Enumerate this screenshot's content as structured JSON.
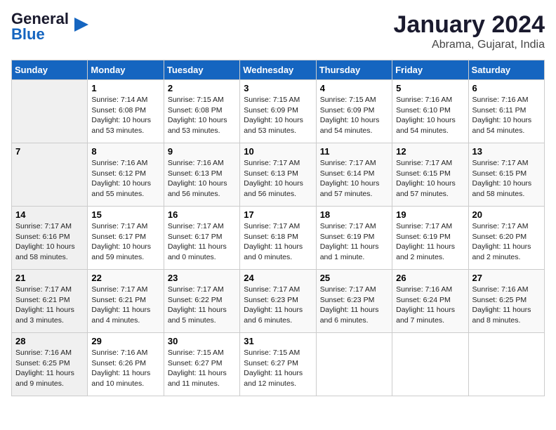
{
  "header": {
    "logo_general": "General",
    "logo_blue": "Blue",
    "title": "January 2024",
    "subtitle": "Abrama, Gujarat, India"
  },
  "weekdays": [
    "Sunday",
    "Monday",
    "Tuesday",
    "Wednesday",
    "Thursday",
    "Friday",
    "Saturday"
  ],
  "weeks": [
    [
      {
        "day": "",
        "info": ""
      },
      {
        "day": "1",
        "info": "Sunrise: 7:14 AM\nSunset: 6:08 PM\nDaylight: 10 hours\nand 53 minutes."
      },
      {
        "day": "2",
        "info": "Sunrise: 7:15 AM\nSunset: 6:08 PM\nDaylight: 10 hours\nand 53 minutes."
      },
      {
        "day": "3",
        "info": "Sunrise: 7:15 AM\nSunset: 6:09 PM\nDaylight: 10 hours\nand 53 minutes."
      },
      {
        "day": "4",
        "info": "Sunrise: 7:15 AM\nSunset: 6:09 PM\nDaylight: 10 hours\nand 54 minutes."
      },
      {
        "day": "5",
        "info": "Sunrise: 7:16 AM\nSunset: 6:10 PM\nDaylight: 10 hours\nand 54 minutes."
      },
      {
        "day": "6",
        "info": "Sunrise: 7:16 AM\nSunset: 6:11 PM\nDaylight: 10 hours\nand 54 minutes."
      }
    ],
    [
      {
        "day": "7",
        "info": ""
      },
      {
        "day": "8",
        "info": "Sunrise: 7:16 AM\nSunset: 6:12 PM\nDaylight: 10 hours\nand 55 minutes."
      },
      {
        "day": "9",
        "info": "Sunrise: 7:16 AM\nSunset: 6:13 PM\nDaylight: 10 hours\nand 56 minutes."
      },
      {
        "day": "10",
        "info": "Sunrise: 7:17 AM\nSunset: 6:13 PM\nDaylight: 10 hours\nand 56 minutes."
      },
      {
        "day": "11",
        "info": "Sunrise: 7:17 AM\nSunset: 6:14 PM\nDaylight: 10 hours\nand 57 minutes."
      },
      {
        "day": "12",
        "info": "Sunrise: 7:17 AM\nSunset: 6:15 PM\nDaylight: 10 hours\nand 57 minutes."
      },
      {
        "day": "13",
        "info": "Sunrise: 7:17 AM\nSunset: 6:15 PM\nDaylight: 10 hours\nand 58 minutes."
      }
    ],
    [
      {
        "day": "14",
        "info": "Sunrise: 7:17 AM\nSunset: 6:16 PM\nDaylight: 10 hours\nand 58 minutes."
      },
      {
        "day": "15",
        "info": "Sunrise: 7:17 AM\nSunset: 6:17 PM\nDaylight: 10 hours\nand 59 minutes."
      },
      {
        "day": "16",
        "info": "Sunrise: 7:17 AM\nSunset: 6:17 PM\nDaylight: 11 hours\nand 0 minutes."
      },
      {
        "day": "17",
        "info": "Sunrise: 7:17 AM\nSunset: 6:18 PM\nDaylight: 11 hours\nand 0 minutes."
      },
      {
        "day": "18",
        "info": "Sunrise: 7:17 AM\nSunset: 6:19 PM\nDaylight: 11 hours\nand 1 minute."
      },
      {
        "day": "19",
        "info": "Sunrise: 7:17 AM\nSunset: 6:19 PM\nDaylight: 11 hours\nand 2 minutes."
      },
      {
        "day": "20",
        "info": "Sunrise: 7:17 AM\nSunset: 6:20 PM\nDaylight: 11 hours\nand 2 minutes."
      }
    ],
    [
      {
        "day": "21",
        "info": "Sunrise: 7:17 AM\nSunset: 6:21 PM\nDaylight: 11 hours\nand 3 minutes."
      },
      {
        "day": "22",
        "info": "Sunrise: 7:17 AM\nSunset: 6:21 PM\nDaylight: 11 hours\nand 4 minutes."
      },
      {
        "day": "23",
        "info": "Sunrise: 7:17 AM\nSunset: 6:22 PM\nDaylight: 11 hours\nand 5 minutes."
      },
      {
        "day": "24",
        "info": "Sunrise: 7:17 AM\nSunset: 6:23 PM\nDaylight: 11 hours\nand 6 minutes."
      },
      {
        "day": "25",
        "info": "Sunrise: 7:17 AM\nSunset: 6:23 PM\nDaylight: 11 hours\nand 6 minutes."
      },
      {
        "day": "26",
        "info": "Sunrise: 7:16 AM\nSunset: 6:24 PM\nDaylight: 11 hours\nand 7 minutes."
      },
      {
        "day": "27",
        "info": "Sunrise: 7:16 AM\nSunset: 6:25 PM\nDaylight: 11 hours\nand 8 minutes."
      }
    ],
    [
      {
        "day": "28",
        "info": "Sunrise: 7:16 AM\nSunset: 6:25 PM\nDaylight: 11 hours\nand 9 minutes."
      },
      {
        "day": "29",
        "info": "Sunrise: 7:16 AM\nSunset: 6:26 PM\nDaylight: 11 hours\nand 10 minutes."
      },
      {
        "day": "30",
        "info": "Sunrise: 7:15 AM\nSunset: 6:27 PM\nDaylight: 11 hours\nand 11 minutes."
      },
      {
        "day": "31",
        "info": "Sunrise: 7:15 AM\nSunset: 6:27 PM\nDaylight: 11 hours\nand 12 minutes."
      },
      {
        "day": "",
        "info": ""
      },
      {
        "day": "",
        "info": ""
      },
      {
        "day": "",
        "info": ""
      }
    ]
  ]
}
